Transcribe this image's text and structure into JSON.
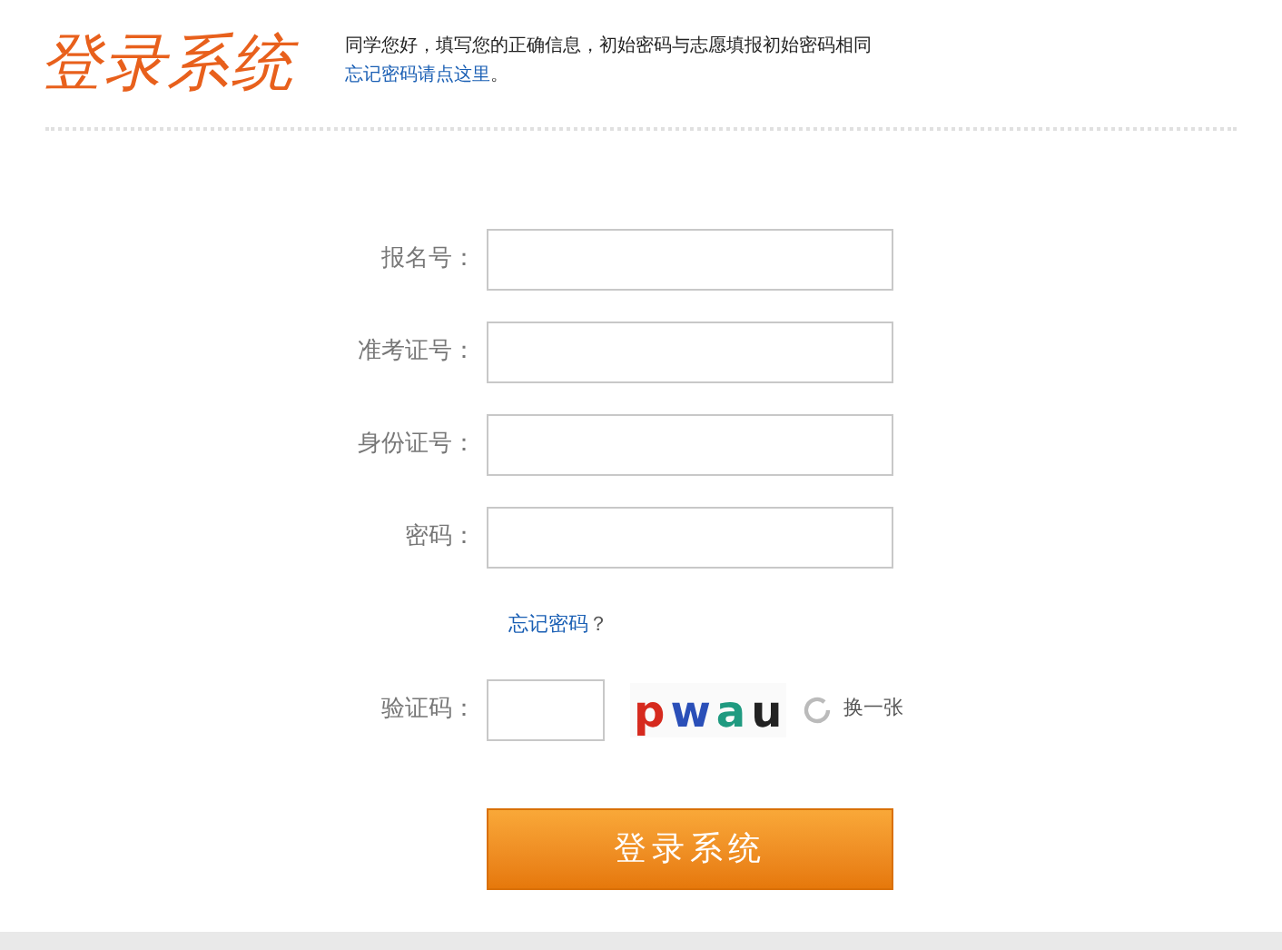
{
  "header": {
    "title": "登录系统",
    "notice": "同学您好，填写您的正确信息，初始密码与志愿填报初始密码相同",
    "notice_link": "忘记密码请点这里",
    "notice_end": "。"
  },
  "fields": [
    {
      "label": "报名号："
    },
    {
      "label": "准考证号："
    },
    {
      "label": "身份证号："
    },
    {
      "label": "密码："
    }
  ],
  "forgot": {
    "link": "忘记密码",
    "mark": "？"
  },
  "captcha": {
    "label": "验证码：",
    "letters": [
      {
        "text": "p",
        "color": "#d62a1e"
      },
      {
        "text": "w",
        "color": "#2a4fb8"
      },
      {
        "text": "a",
        "color": "#1f9a80"
      },
      {
        "text": "u",
        "color": "#222222"
      }
    ],
    "refresh": "换一张"
  },
  "submit": "登录系统"
}
